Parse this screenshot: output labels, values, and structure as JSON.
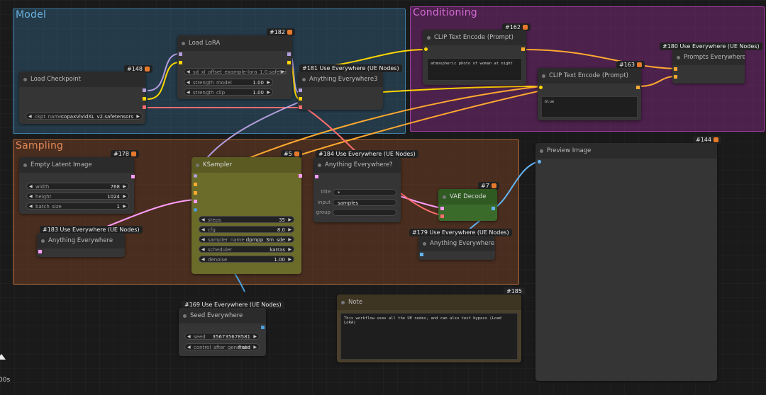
{
  "groups": {
    "model": "Model",
    "conditioning": "Conditioning",
    "sampling": "Sampling"
  },
  "nodes": {
    "checkpoint": {
      "badge": "#148",
      "title": "Load Checkpoint",
      "ckpt_label": "ckpt_name",
      "ckpt_value": "copaxVividXL_v2.safetensors"
    },
    "lora": {
      "badge": "#182",
      "title": "Load LoRA",
      "lora_label": "sd_xl_offset_example-lora_1.0.safetensors",
      "strength_model_label": "strength_model",
      "strength_model_value": "1.00",
      "strength_clip_label": "strength_clip",
      "strength_clip_value": "1.00"
    },
    "anything3": {
      "badge": "#181 Use Everywhere (UE Nodes)",
      "title": "Anything Everywhere3"
    },
    "clip1": {
      "badge": "#162",
      "title": "CLIP Text Encode (Prompt)",
      "text": "atmospheric photo of woman at night"
    },
    "clip2": {
      "badge": "#163",
      "title": "CLIP Text Encode (Prompt)",
      "text": "blue"
    },
    "prompts": {
      "badge": "#180 Use Everywhere (UE Nodes)",
      "title": "Prompts Everywhere"
    },
    "latent": {
      "badge": "#178",
      "title": "Empty Latent Image",
      "width_label": "width",
      "width_value": "768",
      "height_label": "height",
      "height_value": "1024",
      "batch_label": "batch_size",
      "batch_value": "1"
    },
    "ksampler": {
      "badge": "#5",
      "title": "KSampler",
      "steps_label": "steps",
      "steps_value": "35",
      "cfg_label": "cfg",
      "cfg_value": "8.0",
      "sampler_label": "sampler_name",
      "sampler_value": "dpmpp_3m_sde",
      "scheduler_label": "scheduler",
      "scheduler_value": "karras",
      "denoise_label": "denoise",
      "denoise_value": "1.00"
    },
    "anything_q": {
      "badge": "#184 Use Everywhere (UE Nodes)",
      "title": "Anything Everywhere?",
      "title_label": "title",
      "title_value": "*",
      "input_label": "input",
      "input_value": "samples",
      "group_label": "group",
      "group_value": ""
    },
    "vae": {
      "badge": "#7",
      "title": "VAE Decode"
    },
    "anything_183": {
      "badge": "#183 Use Everywhere (UE Nodes)",
      "title": "Anything Everywhere"
    },
    "anything_179": {
      "badge": "#179 Use Everywhere (UE Nodes)",
      "title": "Anything Everywhere"
    },
    "preview": {
      "badge": "#144",
      "title": "Preview Image"
    },
    "seed": {
      "badge": "#169 Use Everywhere (UE Nodes)",
      "title": "Seed Everywhere",
      "seed_label": "seed",
      "seed_value": "356735678581",
      "control_label": "control_after_generate",
      "control_value": "fixed"
    },
    "note": {
      "badge": "#185",
      "title": "Note",
      "text": "This workflow uses all the UE nodes, and can also test bypass (Load LoRA)"
    }
  },
  "corner": {
    "time": "00s"
  },
  "colors": {
    "model_group": "#3f7fa8",
    "conditioning_group": "#a43ca4",
    "sampling_group": "#b0683a",
    "wire_model": "#b39ddb",
    "wire_clip": "#ffd500",
    "wire_cond": "#ffa931",
    "wire_latent": "#ff9cf9",
    "wire_vae": "#ff6e6e",
    "wire_image": "#64b5f6",
    "ksampler_bg": "#6b6b2a",
    "vae_bg": "#3b6b2a",
    "note_bg": "#4a3f2a"
  }
}
